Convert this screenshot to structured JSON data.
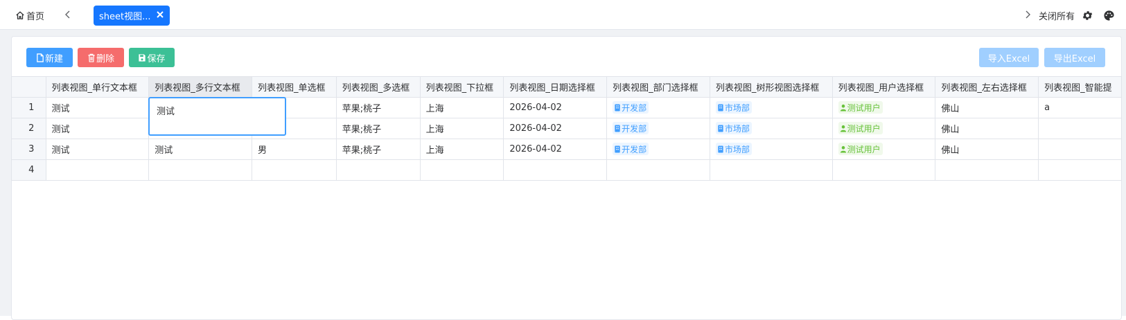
{
  "topbar": {
    "home_label": "首页",
    "active_tab_label": "sheet视图...",
    "close_all_label": "关闭所有"
  },
  "toolbar": {
    "new_label": "新建",
    "delete_label": "删除",
    "save_label": "保存",
    "import_label": "导入Excel",
    "export_label": "导出Excel"
  },
  "colors": {
    "primary": "#1677ff",
    "new_button": "#409eff",
    "delete_button": "#f56c6c",
    "save_button": "#3cc096",
    "excel_buttons": "#a0cfff",
    "dept_tag": "#409eff",
    "user_tag": "#67c23a"
  },
  "grid": {
    "columns": [
      "列表视图_单行文本框",
      "列表视图_多行文本框",
      "列表视图_单选框",
      "列表视图_多选框",
      "列表视图_下拉框",
      "列表视图_日期选择框",
      "列表视图_部门选择框",
      "列表视图_树形视图选择框",
      "列表视图_用户选择框",
      "列表视图_左右选择框",
      "列表视图_智能提"
    ],
    "rows": [
      {
        "num": "1",
        "c1": "测试",
        "c2": "",
        "c3": "",
        "c4": "苹果;桃子",
        "c5": "上海",
        "c6": "2026-04-02",
        "c7": "开发部",
        "c8": "市场部",
        "c9": "测试用户",
        "c10": "佛山",
        "c11": "a"
      },
      {
        "num": "2",
        "c1": "测试",
        "c2": "",
        "c3": "",
        "c4": "苹果;桃子",
        "c5": "上海",
        "c6": "2026-04-02",
        "c7": "开发部",
        "c8": "市场部",
        "c9": "测试用户",
        "c10": "佛山",
        "c11": ""
      },
      {
        "num": "3",
        "c1": "测试",
        "c2": "测试",
        "c3": "男",
        "c4": "苹果;桃子",
        "c5": "上海",
        "c6": "2026-04-02",
        "c7": "开发部",
        "c8": "市场部",
        "c9": "测试用户",
        "c10": "佛山",
        "c11": ""
      },
      {
        "num": "4",
        "c1": "",
        "c2": "",
        "c3": "",
        "c4": "",
        "c5": "",
        "c6": "",
        "c7": "",
        "c8": "",
        "c9": "",
        "c10": "",
        "c11": ""
      }
    ],
    "editor_value": "测试"
  }
}
